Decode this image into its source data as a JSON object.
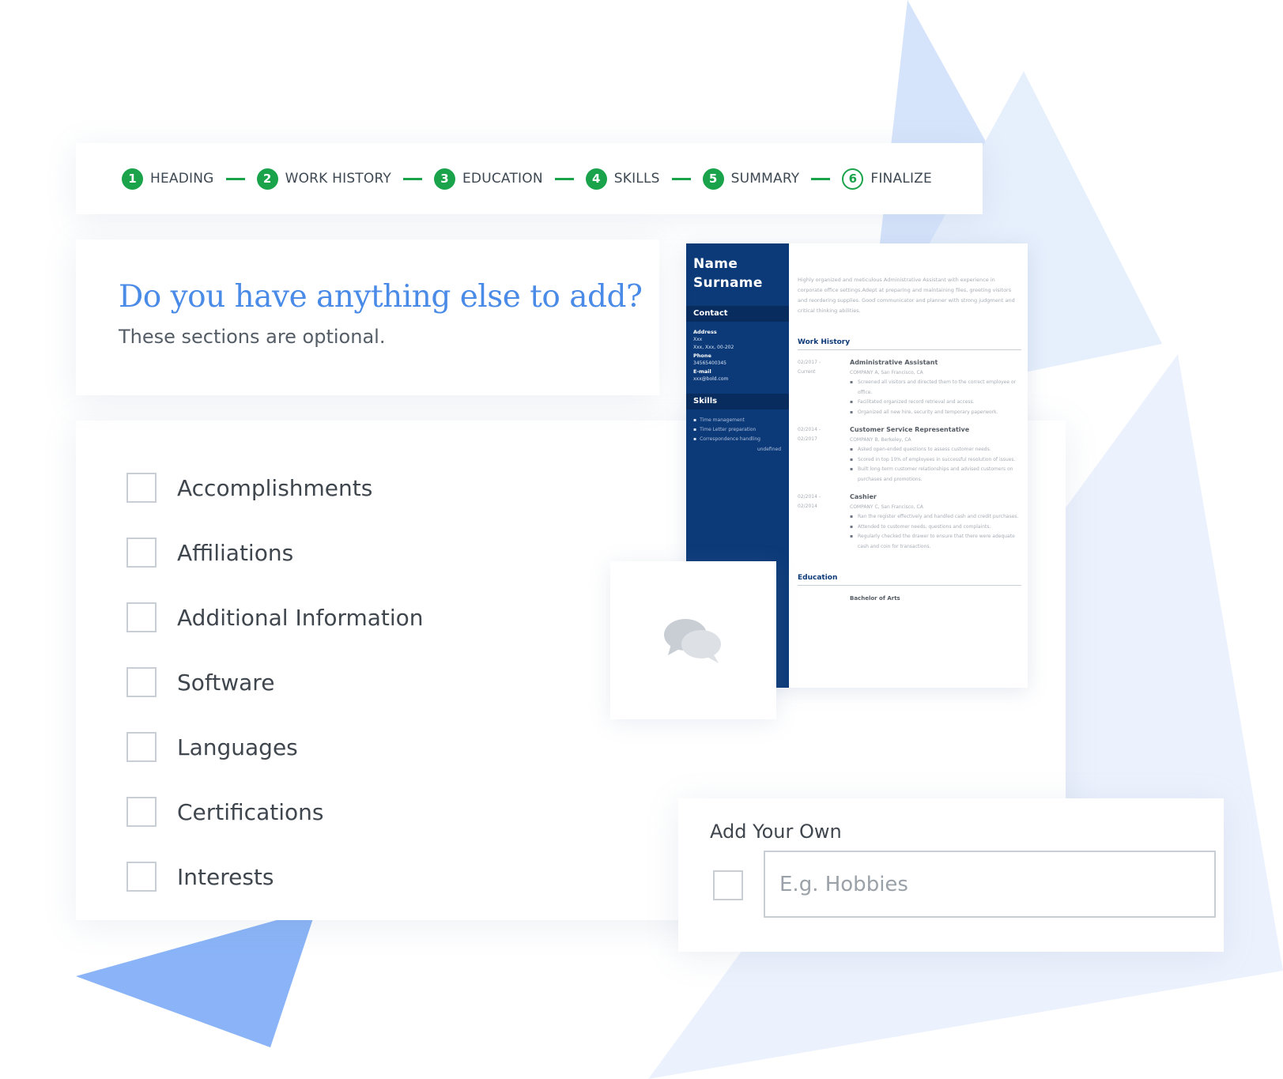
{
  "stepper": {
    "steps": [
      {
        "number": "1",
        "label": "HEADING"
      },
      {
        "number": "2",
        "label": "WORK HISTORY"
      },
      {
        "number": "3",
        "label": "EDUCATION"
      },
      {
        "number": "4",
        "label": "SKILLS"
      },
      {
        "number": "5",
        "label": "SUMMARY"
      },
      {
        "number": "6",
        "label": "FINALIZE"
      }
    ],
    "active_color": "#1aa34a"
  },
  "header": {
    "title": "Do you have anything else to add?",
    "subtitle": "These sections are optional."
  },
  "sections": {
    "options": [
      {
        "label": "Accomplishments",
        "checked": false
      },
      {
        "label": "Affiliations",
        "checked": false
      },
      {
        "label": "Additional Information",
        "checked": false
      },
      {
        "label": "Software",
        "checked": false
      },
      {
        "label": "Languages",
        "checked": false
      },
      {
        "label": "Certifications",
        "checked": false
      },
      {
        "label": "Interests",
        "checked": false
      }
    ]
  },
  "tip": {
    "icon": "chat-bubbles-icon"
  },
  "add_your_own": {
    "title": "Add Your Own",
    "placeholder": "E.g. Hobbies",
    "value": ""
  },
  "resume_preview": {
    "name_line1": "Name",
    "name_line2": "Surname",
    "contact_heading": "Contact",
    "address_label": "Address",
    "address_line1": "Xxx",
    "address_line2": "Xxx, Xxx, 00-202",
    "phone_label": "Phone",
    "phone": "34565400345",
    "email_label": "E-mail",
    "email": "xxx@bold.com",
    "skills_heading": "Skills",
    "skills": [
      "Time management",
      "Time Letter preparation",
      "Correspondence handling"
    ],
    "skills_footer": "undefined",
    "summary": "Highly organized and meticulous Administrative Assistant with experience in corporate office settings.Adept at preparing and maintaining files, greeting visitors and reordering supplies. Good communicator and planner with strong judgment and critical thinking abilities.",
    "work_heading": "Work History",
    "jobs": [
      {
        "date_start": "02/2017 -",
        "date_end": "Current",
        "title": "Administrative Assistant",
        "company": "COMPANY A, San Francisco, CA",
        "bullets": [
          "Screened all visitors and directed them to the correct employee or office.",
          "Facilitated organized record retrieval and access.",
          "Organized all new hire, security and temporary paperwork."
        ]
      },
      {
        "date_start": "02/2014 -",
        "date_end": "02/2017",
        "title": "Customer Service Representative",
        "company": "COMPANY B, Berkeley, CA",
        "bullets": [
          "Asked open-ended questions to assess customer needs.",
          "Scored in top 10% of employees in successful resolution of issues.",
          "Built long-term customer relationships and advised customers on purchases and promotions."
        ]
      },
      {
        "date_start": "02/2014 -",
        "date_end": "02/2014",
        "title": "Cashier",
        "company": "COMPANY C, San Francisco, CA",
        "bullets": [
          "Ran the register effectively and handled cash and credit purchases.",
          "Attended to customer needs, questions and complaints.",
          "Regularly checked the drawer to ensure that there were adequate cash and coin for transactions."
        ]
      }
    ],
    "education_heading": "Education",
    "degree": "Bachelor of Arts",
    "sidebar_color": "#0c3a78"
  },
  "colors": {
    "accent_blue": "#4a8be8",
    "step_green": "#1aa34a",
    "text_dark": "#3f464d",
    "border_gray": "#c9ced4"
  }
}
